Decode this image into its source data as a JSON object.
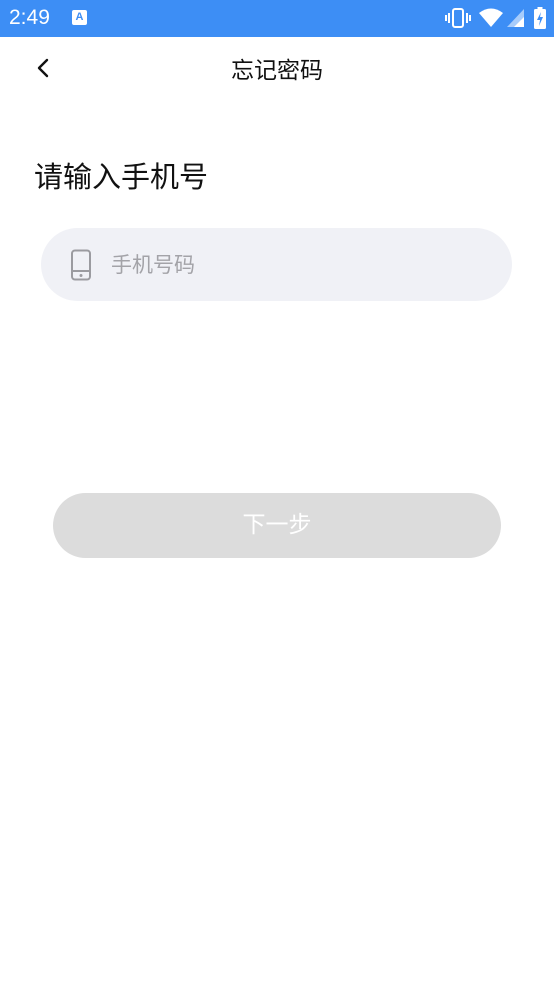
{
  "status_bar": {
    "time": "2:49",
    "app_icon_glyph": "A",
    "icons": [
      "vibrate-icon",
      "wifi-icon",
      "cell-signal-icon",
      "battery-charging-icon"
    ],
    "background": "#3d8ef5"
  },
  "header": {
    "back_icon": "chevron-left-icon",
    "title": "忘记密码"
  },
  "main": {
    "heading": "请输入手机号",
    "phone_field": {
      "icon": "mobile-phone-icon",
      "value": "",
      "placeholder": "手机号码"
    },
    "next_button": {
      "label": "下一步",
      "enabled": false
    }
  },
  "colors": {
    "accent": "#3d8ef5",
    "input_background": "#f0f1f6",
    "disabled_button": "#dcdcdc"
  }
}
